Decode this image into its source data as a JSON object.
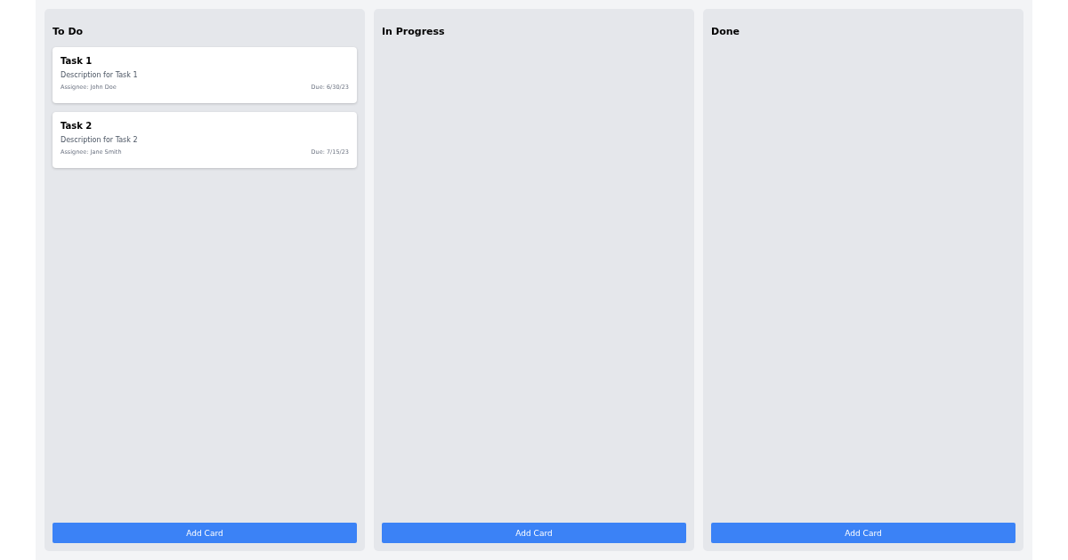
{
  "columns": [
    {
      "title": "To Do",
      "cards": [
        {
          "title": "Task 1",
          "description": "Description for Task 1",
          "assignee": "Assignee: John Doe",
          "due": "Due: 6/30/23"
        },
        {
          "title": "Task 2",
          "description": "Description for Task 2",
          "assignee": "Assignee: Jane Smith",
          "due": "Due: 7/15/23"
        }
      ],
      "button": "Add Card"
    },
    {
      "title": "In Progress",
      "button": "Add Card"
    },
    {
      "title": "Done",
      "button": "Add Card"
    }
  ]
}
